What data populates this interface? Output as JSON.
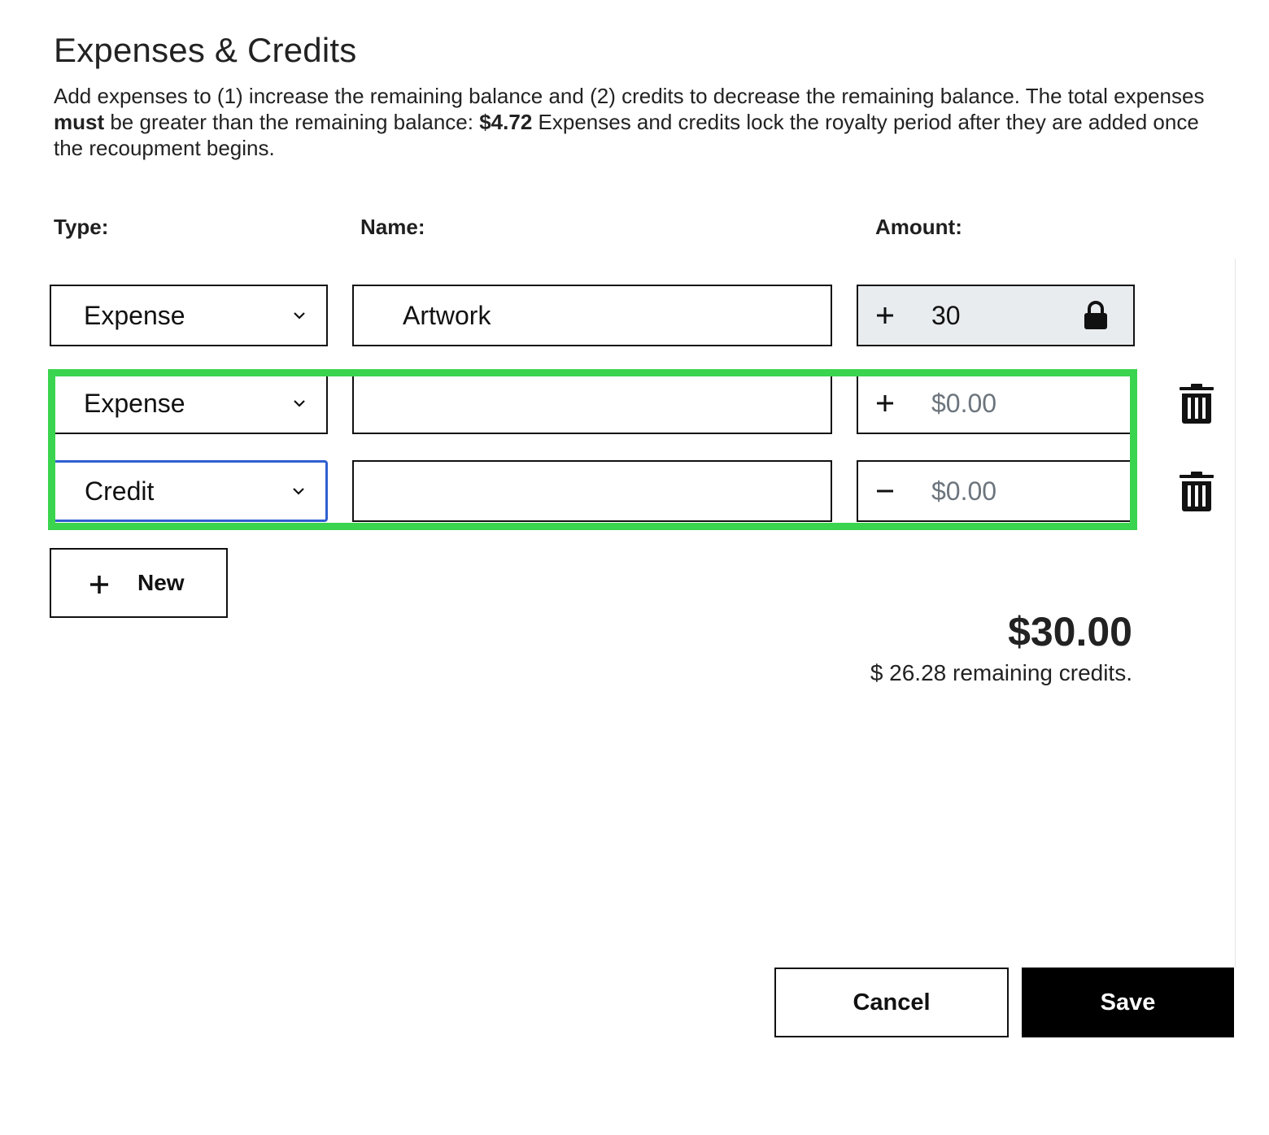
{
  "header": {
    "title": "Expenses & Credits",
    "desc_part1": "Add expenses to (1) increase the remaining balance and (2) credits to decrease the remaining balance. The total expenses ",
    "desc_bold1": "must",
    "desc_part2": " be greater than the remaining balance: ",
    "desc_bold2": "$4.72",
    "desc_part3": " Expenses and credits lock the royalty period after they are added once the recoupment begins."
  },
  "columns": {
    "type": "Type:",
    "name": "Name:",
    "amount": "Amount:"
  },
  "rows": [
    {
      "type": "Expense",
      "name": "Artwork",
      "sign": "plus-icon",
      "amount": "30",
      "amount_placeholder": "",
      "locked": true,
      "focused": false
    },
    {
      "type": "Expense",
      "name": "",
      "sign": "plus-icon",
      "amount": "",
      "amount_placeholder": "$0.00",
      "locked": false,
      "focused": false
    },
    {
      "type": "Credit",
      "name": "",
      "sign": "minus-icon",
      "amount": "",
      "amount_placeholder": "$0.00",
      "locked": false,
      "focused": true
    }
  ],
  "highlight_color": "#3bd44f",
  "focus_color": "#2f5fcf",
  "new_button": {
    "label": "New",
    "icon": "plus-icon"
  },
  "summary": {
    "total": "$30.00",
    "remaining": "$ 26.28 remaining credits."
  },
  "footer": {
    "cancel_label": "Cancel",
    "save_label": "Save"
  }
}
